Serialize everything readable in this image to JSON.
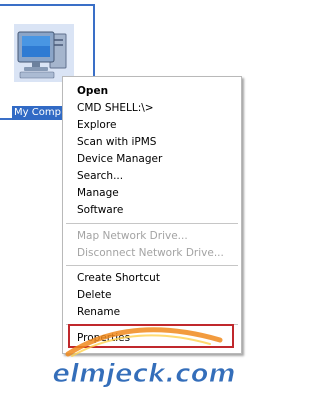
{
  "desktop": {
    "icon_label": "My Comp"
  },
  "context_menu": {
    "items": [
      {
        "label": "Open",
        "bold": true
      },
      {
        "label": "CMD SHELL:\\>"
      },
      {
        "label": "Explore"
      },
      {
        "label": "Scan with iPMS"
      },
      {
        "label": "Device Manager"
      },
      {
        "label": "Search..."
      },
      {
        "label": "Manage"
      },
      {
        "label": "Software"
      },
      {
        "label": "Map Network Drive...",
        "disabled": true
      },
      {
        "label": "Disconnect Network Drive...",
        "disabled": true
      },
      {
        "label": "Create Shortcut"
      },
      {
        "label": "Delete"
      },
      {
        "label": "Rename"
      },
      {
        "label": "Properties"
      }
    ]
  },
  "watermark": "elmjeck.com",
  "colors": {
    "selection": "#316ac5",
    "highlight_border": "#c0282c",
    "disabled_text": "#a3a3a3"
  }
}
